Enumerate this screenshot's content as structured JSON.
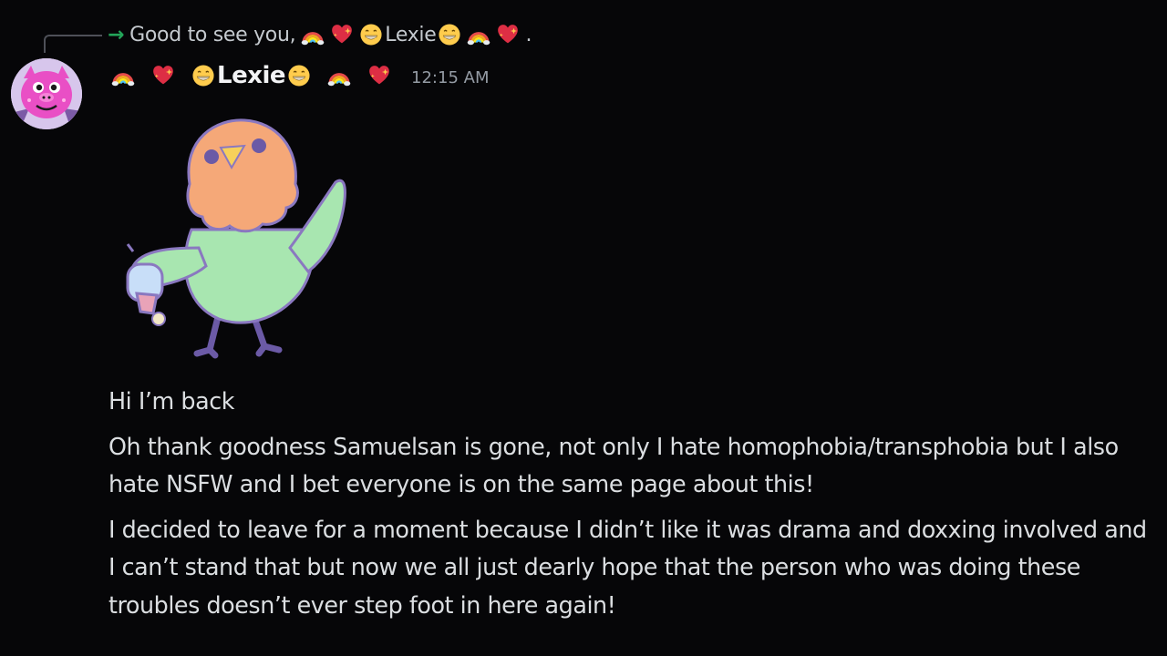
{
  "reply": {
    "text": "Good to see you,",
    "username": "Lexie",
    "trailing": "."
  },
  "author": {
    "username": "Lexie",
    "timestamp": "12:15 AM"
  },
  "icons": {
    "reply_arrow": "reply-arrow-icon",
    "rainbow": "rainbow-emoji",
    "heart": "sparkling-heart-emoji",
    "grin": "grinning-face-emoji",
    "sticker": "parrot-sticker",
    "avatar": "pink-creature-avatar"
  },
  "colors": {
    "background": "#060608",
    "text": "#dbdee1",
    "username": "#f2f3f5",
    "timestamp": "#949ba4",
    "reply_arrow": "#23a559"
  },
  "messages": [
    "Hi I’m back",
    "Oh thank goodness Samuelsan is gone, not only I hate homophobia/transphobia but I also hate NSFW and I bet everyone is on the same page about this!",
    "I decided to leave for a moment because I didn’t like it was drama and doxxing involved and I can’t stand that but now we all just dearly hope that the person who was doing these troubles doesn’t ever step foot in here again!"
  ]
}
